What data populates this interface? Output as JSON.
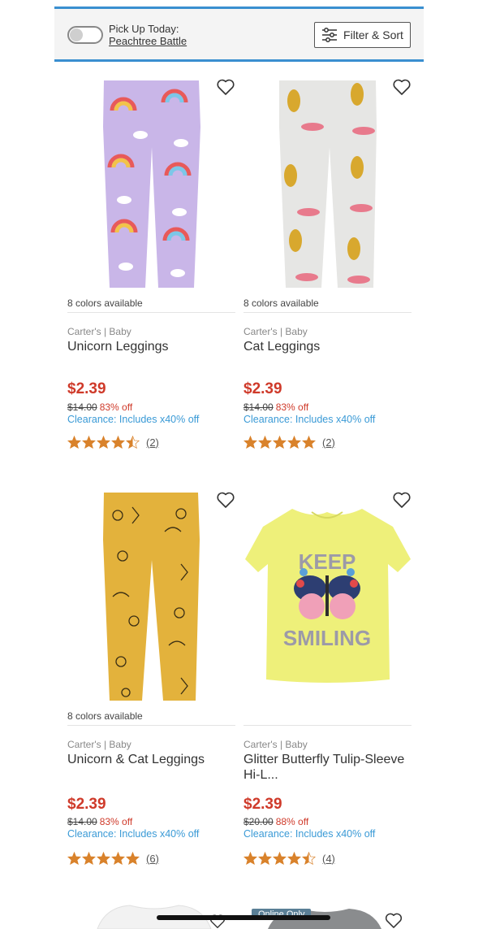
{
  "header": {
    "pickup_label": "Pick Up Today:",
    "store_name": "Peachtree Battle",
    "filter_label": "Filter & Sort"
  },
  "products": [
    {
      "colors": "8 colors available",
      "brand": "Carter's | Baby",
      "title": "Unicorn Leggings",
      "price": "$2.39",
      "was": "$14.00",
      "off": "83% off",
      "clearance": "Clearance: Includes x40% off",
      "rating": 4.5,
      "reviews": "(2)",
      "image": "lavender-unicorn-leggings"
    },
    {
      "colors": "8 colors available",
      "brand": "Carter's | Baby",
      "title": "Cat Leggings",
      "price": "$2.39",
      "was": "$14.00",
      "off": "83% off",
      "clearance": "Clearance: Includes x40% off",
      "rating": 5,
      "reviews": "(2)",
      "image": "gray-leopard-leggings"
    },
    {
      "colors": "8 colors available",
      "brand": "Carter's | Baby",
      "title": "Unicorn & Cat Leggings",
      "price": "$2.39",
      "was": "$14.00",
      "off": "83% off",
      "clearance": "Clearance: Includes x40% off",
      "rating": 5,
      "reviews": "(6)",
      "image": "yellow-doodle-leggings"
    },
    {
      "colors": "",
      "brand": "Carter's | Baby",
      "title": "Glitter Butterfly Tulip-Sleeve Hi-L...",
      "price": "$2.39",
      "was": "$20.00",
      "off": "88% off",
      "clearance": "Clearance: Includes x40% off",
      "rating": 4.5,
      "reviews": "(4)",
      "image": "yellow-butterfly-tee",
      "tee_text_top": "KEEP",
      "tee_text_bottom": "SMILING"
    }
  ],
  "next_row": {
    "badge": "Online Only"
  },
  "colors": {
    "accent_blue": "#3a8fd0",
    "price_red": "#cf3a2a",
    "clearance_blue": "#3a9ad6",
    "star_orange": "#d9822b"
  }
}
